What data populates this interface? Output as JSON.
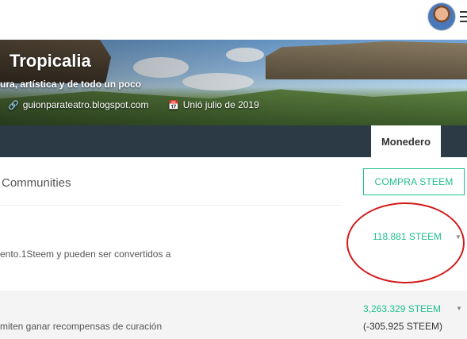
{
  "header": {
    "user_avatar_icon": "user-avatar",
    "menu_icon": "hamburger-icon"
  },
  "banner": {
    "title": "Tropicalia",
    "about": "ura, artística y de todo un poco",
    "website": "guionparateatro.blogspot.com",
    "joined": "Unió julio de 2019",
    "link_icon": "link-icon",
    "calendar_icon": "calendar-icon"
  },
  "nav": {
    "active_tab": "Monedero"
  },
  "wallet": {
    "communities_label": "Communities",
    "buy_button": "COMPRA STEEM",
    "steem": {
      "description": "ento.1Steem y pueden ser convertidos a",
      "value": "118.881 STEEM"
    },
    "steem_power": {
      "description": "miten ganar recompensas de curación",
      "value": "3,263.329 STEEM",
      "delegated": "(-305.925 STEEM)"
    }
  },
  "colors": {
    "accent": "#1fbf8f",
    "nav_bg": "#2c3a46",
    "annotation": "#d41a1a"
  }
}
